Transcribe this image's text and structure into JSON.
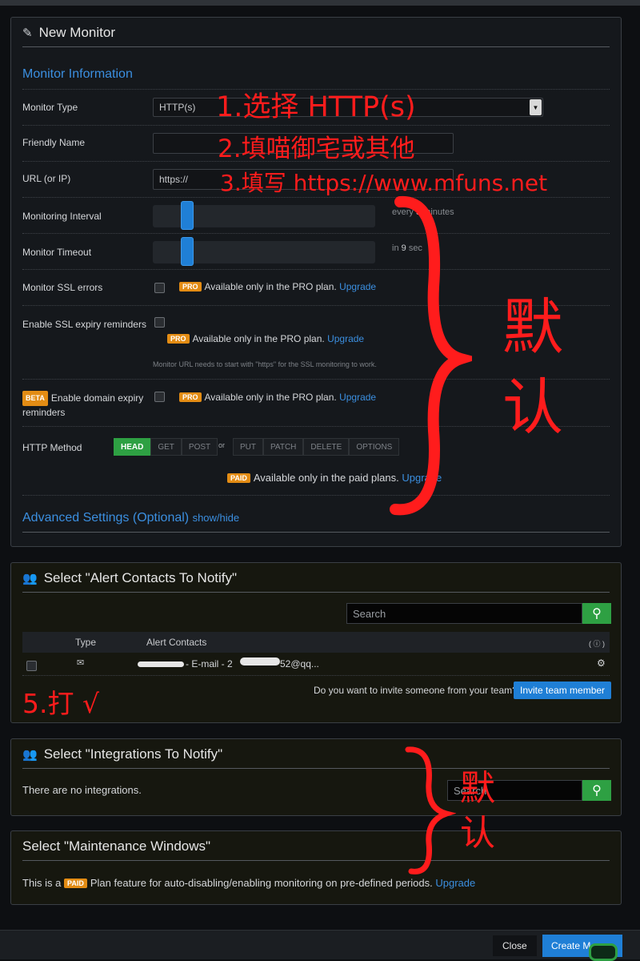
{
  "new_monitor": {
    "title": "New Monitor",
    "section_info": "Monitor Information",
    "monitor_type": {
      "label": "Monitor Type",
      "value": "HTTP(s)"
    },
    "friendly_name": {
      "label": "Friendly Name",
      "value": ""
    },
    "url": {
      "label": "URL (or IP)",
      "value": "https://"
    },
    "monitoring_interval": {
      "label": "Monitoring Interval",
      "hint_prefix": "every",
      "hint_value": "5",
      "hint_suffix": "minutes"
    },
    "monitor_timeout": {
      "label": "Monitor Timeout",
      "hint_prefix": "in",
      "hint_value": "9",
      "hint_suffix": "sec"
    },
    "ssl_errors": {
      "label": "Monitor SSL errors",
      "badge": "PRO",
      "text": "Available only in the PRO plan.",
      "link": "Upgrade"
    },
    "ssl_expiry": {
      "label": "Enable SSL expiry reminders",
      "badge": "PRO",
      "text": "Available only in the PRO plan.",
      "link": "Upgrade",
      "note": "Monitor URL needs to start with \"https\" for the SSL monitoring to work."
    },
    "domain_expiry": {
      "beta": "BETA",
      "label_line1": "Enable domain expiry",
      "label_line2": "reminders",
      "badge": "PRO",
      "text": "Available only in the PRO plan.",
      "link": "Upgrade"
    },
    "http_method": {
      "label": "HTTP Method",
      "group1": [
        "HEAD",
        "GET",
        "POST"
      ],
      "or": "or",
      "group2": [
        "PUT",
        "PATCH",
        "DELETE",
        "OPTIONS"
      ],
      "paid_badge": "PAID",
      "paid_text": "Available only in the paid plans.",
      "paid_link": "Upgrade"
    },
    "advanced": {
      "title": "Advanced Settings (Optional)",
      "link": "show/hide"
    }
  },
  "alert_contacts": {
    "title": "Select \"Alert Contacts To Notify\"",
    "search_placeholder": "Search",
    "col_type": "Type",
    "col_contacts": "Alert Contacts",
    "col_info": "( ⓘ )",
    "row_contact": "- E-mail - 2",
    "row_contact_end": "52@qq...",
    "invite_text": "Do you want to invite someone from your team?",
    "invite_button": "Invite team member"
  },
  "integrations": {
    "title": "Select \"Integrations To Notify\"",
    "empty": "There are no integrations.",
    "search_placeholder": "Search"
  },
  "maintenance": {
    "title": "Select \"Maintenance Windows\"",
    "text_pre": "This is a",
    "badge": "PAID",
    "text_post": "Plan feature for auto-disabling/enabling monitoring on pre-defined periods.",
    "link": "Upgrade"
  },
  "footer": {
    "close": "Close",
    "create": "Create M"
  },
  "annotations": {
    "a1": "1.选择 HTTP(s)",
    "a2": "2.填喵御宅或其他",
    "a3": "3.填写 https://www.mfuns.net",
    "default_big": [
      "默",
      "认"
    ],
    "a5": "5.打 √",
    "default_small": [
      "默",
      "认"
    ]
  },
  "colors": {
    "accent": "#3b8fe0",
    "green": "#2ea043",
    "orange": "#e38c14",
    "annotation": "#ff1c1c"
  }
}
